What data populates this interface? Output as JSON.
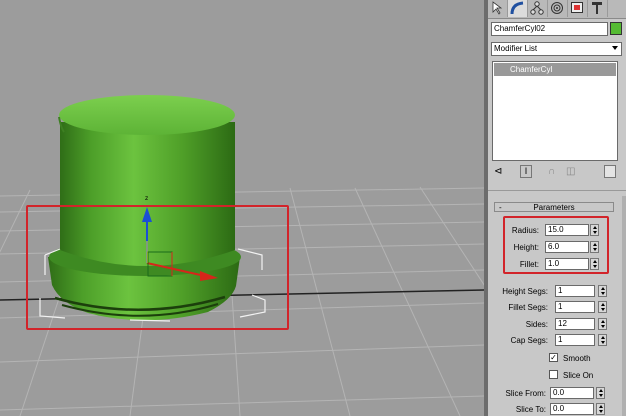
{
  "colors": {
    "viewport_bg": "#9c9c9c",
    "object": "#4fa82a",
    "object_highlight": "#7fd24c",
    "object_shadow": "#2e6b16",
    "object_swatch": "#55bb33",
    "highlight": "#d2242a",
    "grid": "#b4b4b4"
  },
  "command_panel": {
    "tabs": [
      {
        "name": "create",
        "icon": "pointer-icon"
      },
      {
        "name": "modify",
        "icon": "modify-arc-icon"
      },
      {
        "name": "hierarchy",
        "icon": "hierarchy-icon"
      },
      {
        "name": "motion",
        "icon": "motion-icon"
      },
      {
        "name": "display",
        "icon": "display-icon"
      },
      {
        "name": "utilities",
        "icon": "hammer-icon"
      }
    ],
    "object_name": "ChamferCyl02",
    "modifier_list": "Modifier List",
    "stack_items": [
      "ChamferCyl"
    ]
  },
  "parameters": {
    "title": "Parameters",
    "radius_label": "Radius:",
    "radius": "15.0",
    "height_label": "Height:",
    "height": "6.0",
    "fillet_label": "Fillet:",
    "fillet": "1.0",
    "height_segs_label": "Height Segs:",
    "height_segs": "1",
    "fillet_segs_label": "Fillet Segs:",
    "fillet_segs": "1",
    "sides_label": "Sides:",
    "sides": "12",
    "cap_segs_label": "Cap Segs:",
    "cap_segs": "1",
    "smooth_label": "Smooth",
    "smooth_checked": true,
    "slice_on_label": "Slice On",
    "slice_on_checked": false,
    "slice_from_label": "Slice From:",
    "slice_from": "0.0",
    "slice_to_label": "Slice To:",
    "slice_to": "0.0"
  }
}
